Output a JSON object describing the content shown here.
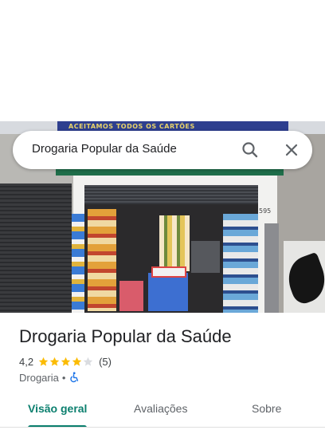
{
  "search": {
    "query": "Drogaria Popular da Saúde"
  },
  "photo": {
    "banner_text": "ACEITAMOS TODOS OS CARTÕES",
    "street_number": "595"
  },
  "place": {
    "name": "Drogaria Popular da Saúde",
    "rating": "4,2",
    "rating_stars": 4.2,
    "reviews_count": "(5)",
    "category": "Drogaria",
    "separator": "•",
    "accessibility": "wheelchair-icon"
  },
  "tabs": [
    {
      "label": "Visão geral",
      "active": true
    },
    {
      "label": "Avaliações",
      "active": false
    },
    {
      "label": "Sobre",
      "active": false
    }
  ],
  "colors": {
    "accent": "#0b7f6e",
    "star": "#fbbc04",
    "star_empty": "#dadce0",
    "accessibility_blue": "#1a73e8"
  }
}
